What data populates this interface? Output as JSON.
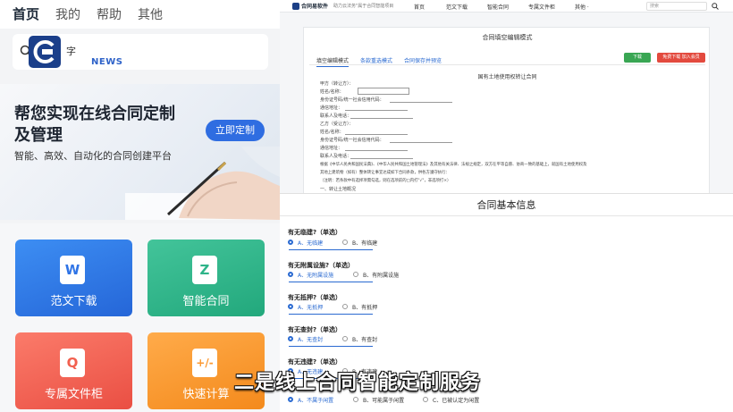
{
  "mobile": {
    "tabs": [
      {
        "label": "首页",
        "active": true
      },
      {
        "label": "我的",
        "active": false
      },
      {
        "label": "帮助",
        "active": false
      },
      {
        "label": "其他",
        "active": false
      }
    ],
    "search": {
      "text": "字",
      "brand_word": "NEWS"
    },
    "banner": {
      "title": "帮您实现在线合同定制及管理",
      "subtitle": "智能、高效、自动化的合同创建平台",
      "button": "立即定制"
    },
    "cards": [
      {
        "label": "范文下载",
        "icon": "W",
        "color": "#2f74e6"
      },
      {
        "label": "智能合同",
        "icon": "Z",
        "color": "#2eb489"
      },
      {
        "label": "专属文件柜",
        "icon": "Q",
        "color": "#f2604f"
      },
      {
        "label": "快速计算",
        "icon": "+/-",
        "color": "#fb9a33"
      }
    ]
  },
  "desktop": {
    "brand": "合同易软件",
    "slogan": "助力云法务\"属于合同智能项目",
    "nav": [
      "首页",
      "范文下载",
      "智能合同",
      "专属文件柜",
      "其他 ·"
    ],
    "search_placeholder": "搜索",
    "panel_title": "合同填空编辑模式",
    "tabs": [
      "填空编辑模式",
      "条款重选模式",
      "合同保存并预览"
    ],
    "btn_download": "下载",
    "btn_free": "免费下载 加入会员",
    "doc_title": "国有土地使用权转让合同",
    "doc_lines": [
      "甲方（转让方）：",
      "姓名/名称：",
      "身份证号码/统一社会信用代码：",
      "通信地址：",
      "联系人及电话：",
      "乙方（受让方）：",
      "姓名/名称：",
      "身份证号码/统一社会信用代码：",
      "通信地址：",
      "联系人及电话：",
      "根据《中华人民共和国民法典》、《中华人民共和国土地管理法》及其他有关法律、法规之规定，双方在平等自愿、协商一致的基础上，就国有土地使用权及",
      "其地上建筑物（如有）整体转让事宜达成如下合同条款，供各方遵守执行：",
      "（注明：若条款中有选择项需勾选，则在选项前的□内打\"√\"，非选项打×）",
      "一、转让土地概况"
    ]
  },
  "form": {
    "title": "合同基本信息",
    "questions": [
      {
        "label": "有无临建?（单选）",
        "options": [
          "A、无临建",
          "B、有临建"
        ],
        "selected": 0
      },
      {
        "label": "有无附属设施?（单选）",
        "options": [
          "A、无附属设施",
          "B、有附属设施"
        ],
        "selected": 0
      },
      {
        "label": "有无抵押?（单选）",
        "options": [
          "A、无抵押",
          "B、有抵押"
        ],
        "selected": 0
      },
      {
        "label": "有无查封?（单选）",
        "options": [
          "A、无查封",
          "B、有查封"
        ],
        "selected": 0
      },
      {
        "label": "有无违建?（单选）",
        "options": [
          "A、无违建",
          "B、有违建"
        ],
        "selected": 0
      },
      {
        "label": "",
        "options": [
          "A、不属于闲置",
          "B、可能属于闲置",
          "C、已被认定为闲置"
        ],
        "selected": 0
      }
    ]
  },
  "caption": "二是线上合同智能定制服务",
  "colors": {
    "accent": "#2a6ad1",
    "green": "#39a653",
    "red": "#e34a3e"
  }
}
